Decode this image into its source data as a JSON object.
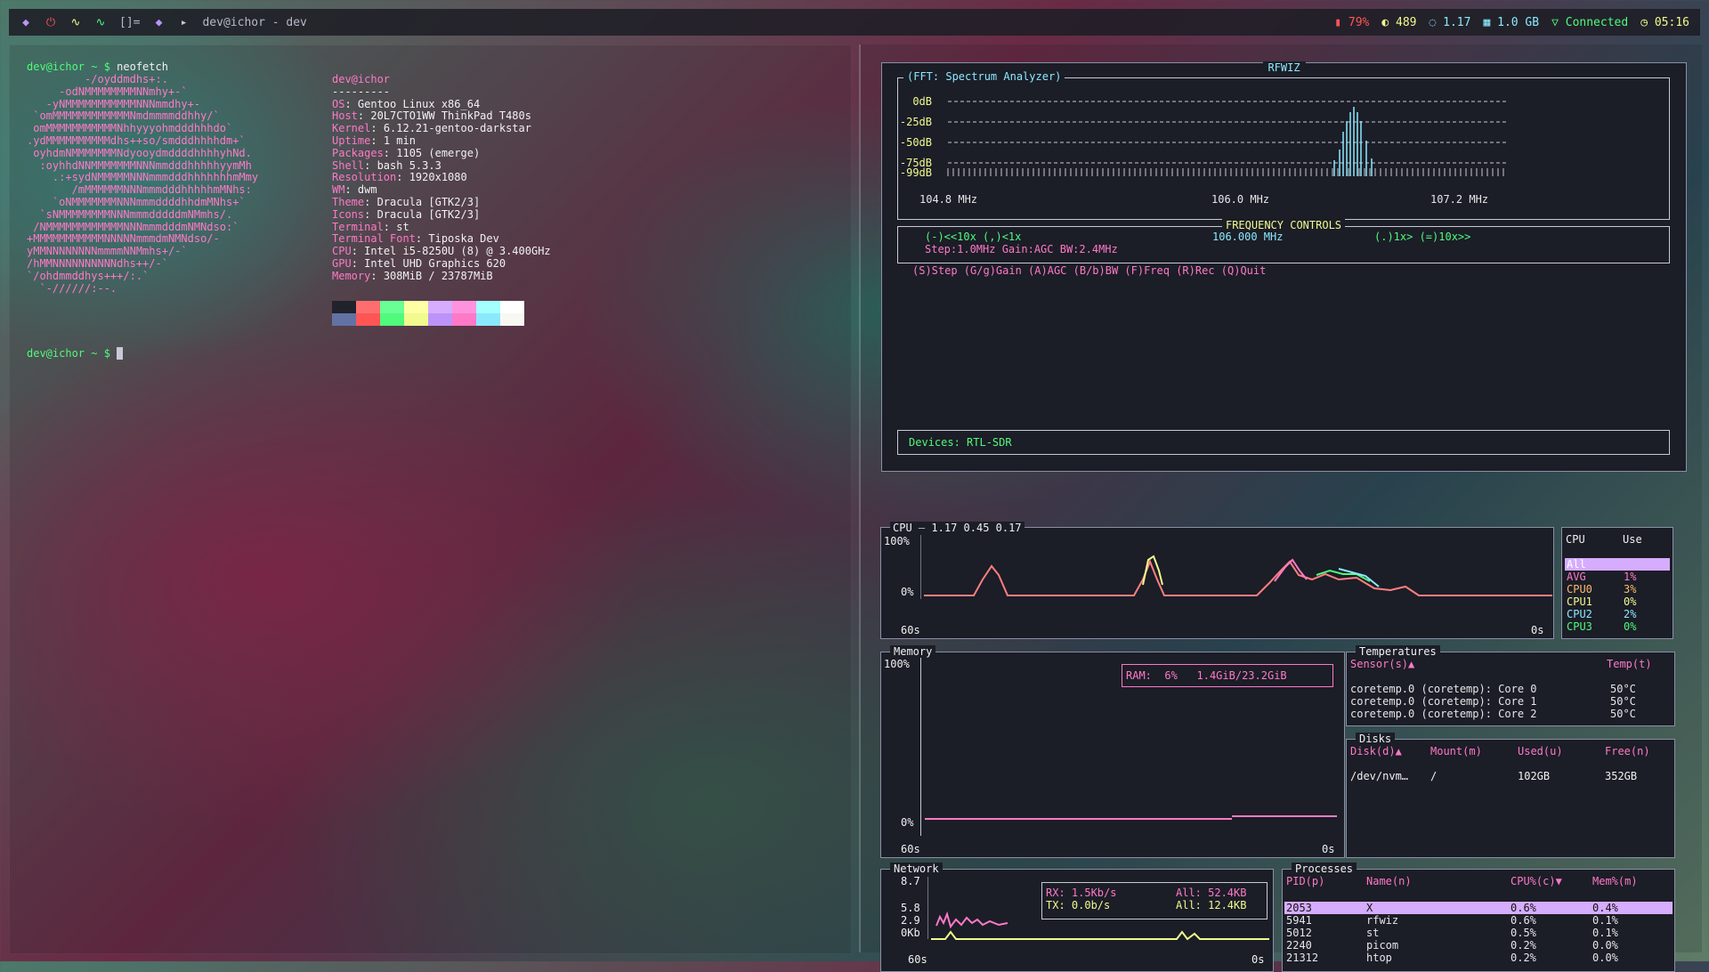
{
  "bar": {
    "window_title": "dev@ichor - dev",
    "layout": "[]=",
    "status": [
      {
        "icon": "battery-icon",
        "text": "79%",
        "color": "#ff5555"
      },
      {
        "icon": "updates-icon",
        "text": "489",
        "color": "#f1fa8c"
      },
      {
        "icon": "load-icon",
        "text": "1.17",
        "color": "#8be9fd"
      },
      {
        "icon": "memory-icon",
        "text": "1.0 GB",
        "color": "#8be9fd"
      },
      {
        "icon": "wifi-icon",
        "text": "Connected",
        "color": "#50fa7b"
      },
      {
        "icon": "clock-icon",
        "text": "05:16",
        "color": "#f1fa8c"
      }
    ]
  },
  "terminal": {
    "prompt1": "dev@ichor ~ $",
    "command1": "neofetch",
    "prompt2": "dev@ichor ~ $",
    "ascii": [
      "         -/oyddmdhs+:.",
      "     -odNMMMMMMMMNNmhy+-`",
      "   -yNMMMMMMMMMMMNNNmmdhy+-",
      " `omMMMMMMMMMMMMNmdmmmmddhhy/`",
      " omMMMMMMMMMMMNhhyyyohmdddhhhdo`",
      ".ydMMMMMMMMMMdhs++so/smdddhhhhdm+`",
      " oyhdmNMMMMMMMNdyooydmddddhhhhyhNd.",
      "  :oyhhdNNMMMMMMMNNNmmdddhhhhhyymMh",
      "    .:+sydNMMMMMNNNmmmdddhhhhhhhmMmy",
      "       /mMMMMMMNNNmmmdddhhhhhmMNhs:",
      "    `oNMMMMMMMNNNmmmddddhhdmMNhs+`",
      "  `sNMMMMMMMMNNNmmmdddddmNMmhs/.",
      " /NMMMMMMMMMMMMNNNmmmdddmNMNdso:`",
      "+MMMMMMMMMMMNNNNNmmmdmNMNdso/-",
      "yMMNNNNNNNNmmmmNNMmhs+/-`",
      "/hMMNNNNNNNNNNdhs++/-`",
      "`/ohdmmddhys+++/:.`",
      "  `-//////:--."
    ],
    "info_user": "dev@ichor",
    "info_sep": "---------",
    "info": [
      {
        "k": "OS",
        "v": "Gentoo Linux x86_64"
      },
      {
        "k": "Host",
        "v": "20L7CTO1WW ThinkPad T480s"
      },
      {
        "k": "Kernel",
        "v": "6.12.21-gentoo-darkstar"
      },
      {
        "k": "Uptime",
        "v": "1 min"
      },
      {
        "k": "Packages",
        "v": "1105 (emerge)"
      },
      {
        "k": "Shell",
        "v": "bash 5.3.3"
      },
      {
        "k": "Resolution",
        "v": "1920x1080"
      },
      {
        "k": "WM",
        "v": "dwm"
      },
      {
        "k": "Theme",
        "v": "Dracula [GTK2/3]"
      },
      {
        "k": "Icons",
        "v": "Dracula [GTK2/3]"
      },
      {
        "k": "Terminal",
        "v": "st"
      },
      {
        "k": "Terminal Font",
        "v": "Tiposka Dev"
      },
      {
        "k": "CPU",
        "v": "Intel i5-8250U (8) @ 3.400GHz"
      },
      {
        "k": "GPU",
        "v": "Intel UHD Graphics 620"
      },
      {
        "k": "Memory",
        "v": "308MiB / 23787MiB"
      }
    ],
    "palette_top": [
      "#21222c",
      "#ff6e6e",
      "#69ff94",
      "#ffffa5",
      "#d6acff",
      "#ff92df",
      "#a4ffff",
      "#ffffff"
    ],
    "palette_bottom": [
      "#6272a4",
      "#ff5555",
      "#50fa7b",
      "#f1fa8c",
      "#bd93f9",
      "#ff79c6",
      "#8be9fd",
      "#f8f8f2"
    ]
  },
  "rfwiz": {
    "title": "RFWIZ",
    "spectrum_title": "(FFT: Spectrum Analyzer)",
    "db_labels": [
      "0dB",
      "-25dB",
      "-50dB",
      "-75dB",
      "-99dB"
    ],
    "freq_labels": [
      "104.8 MHz",
      "106.0 MHz",
      "107.2 MHz"
    ],
    "controls_title": "FREQUENCY CONTROLS",
    "ctrl_left": "(-)<<10x (,)<1x",
    "ctrl_freq": "106.000 MHz",
    "ctrl_right": "(.)1x> (=)10x>>",
    "ctrl_step": "Step:1.0MHz Gain:AGC BW:2.4MHz",
    "ctrl_keys": "(S)Step (G/g)Gain (A)AGC (B/b)BW (F)Freq (R)Rec (Q)Quit",
    "devices": "Devices: RTL-SDR"
  },
  "btop": {
    "cpu_title": "CPU",
    "cpu_load": "1.17 0.45 0.17",
    "cpu_y_top": "100%",
    "cpu_y_bottom": "0%",
    "cpu_x_left": "60s",
    "cpu_x_right": "0s",
    "cpu_table_headers": [
      "CPU",
      "Use"
    ],
    "cpu_rows": [
      {
        "name": "All",
        "use": "",
        "color": "#111",
        "selected": true
      },
      {
        "name": "AVG",
        "use": "1%",
        "color": "#ff79c6"
      },
      {
        "name": "CPU0",
        "use": "3%",
        "color": "#ffb86c"
      },
      {
        "name": "CPU1",
        "use": "0%",
        "color": "#f1fa8c"
      },
      {
        "name": "CPU2",
        "use": "2%",
        "color": "#8be9fd"
      },
      {
        "name": "CPU3",
        "use": "0%",
        "color": "#50fa7b"
      }
    ],
    "mem_title": "Memory",
    "mem_y_top": "100%",
    "mem_y_bottom": "0%",
    "mem_x_left": "60s",
    "mem_x_right": "0s",
    "ram_label": "RAM:",
    "ram_pct": "6%",
    "ram_used": "1.4GiB/23.2GiB",
    "temp_title": "Temperatures",
    "temp_headers": [
      "Sensor(s)▲",
      "Temp(t)"
    ],
    "temps": [
      {
        "sensor": "coretemp.0 (coretemp): Core 0",
        "temp": "50°C"
      },
      {
        "sensor": "coretemp.0 (coretemp): Core 1",
        "temp": "50°C"
      },
      {
        "sensor": "coretemp.0 (coretemp): Core 2",
        "temp": "50°C"
      }
    ],
    "disk_title": "Disks",
    "disk_headers": [
      "Disk(d)▲",
      "Mount(m)",
      "Used(u)",
      "Free(n)"
    ],
    "disks": [
      {
        "disk": "/dev/nvm…",
        "mount": "/",
        "used": "102GB",
        "free": "352GB"
      }
    ],
    "net_title": "Network",
    "net_y": [
      "8.7",
      "5.8",
      "2.9",
      "0Kb"
    ],
    "net_x_left": "60s",
    "net_x_right": "0s",
    "rx": "RX: 1.5Kb/s",
    "rx_all": "All: 52.4KB",
    "tx": "TX: 0.0b/s",
    "tx_all": "All: 12.4KB",
    "proc_title": "Processes",
    "proc_headers": [
      "PID(p)",
      "Name(n)",
      "CPU%(c)▼",
      "Mem%(m)"
    ],
    "procs": [
      {
        "pid": "2053",
        "name": "X",
        "cpu": "0.6%",
        "mem": "0.4%"
      },
      {
        "pid": "5941",
        "name": "rfwiz",
        "cpu": "0.6%",
        "mem": "0.1%"
      },
      {
        "pid": "5012",
        "name": "st",
        "cpu": "0.5%",
        "mem": "0.1%"
      },
      {
        "pid": "2240",
        "name": "picom",
        "cpu": "0.2%",
        "mem": "0.0%"
      },
      {
        "pid": "21312",
        "name": "htop",
        "cpu": "0.2%",
        "mem": "0.0%"
      }
    ]
  }
}
